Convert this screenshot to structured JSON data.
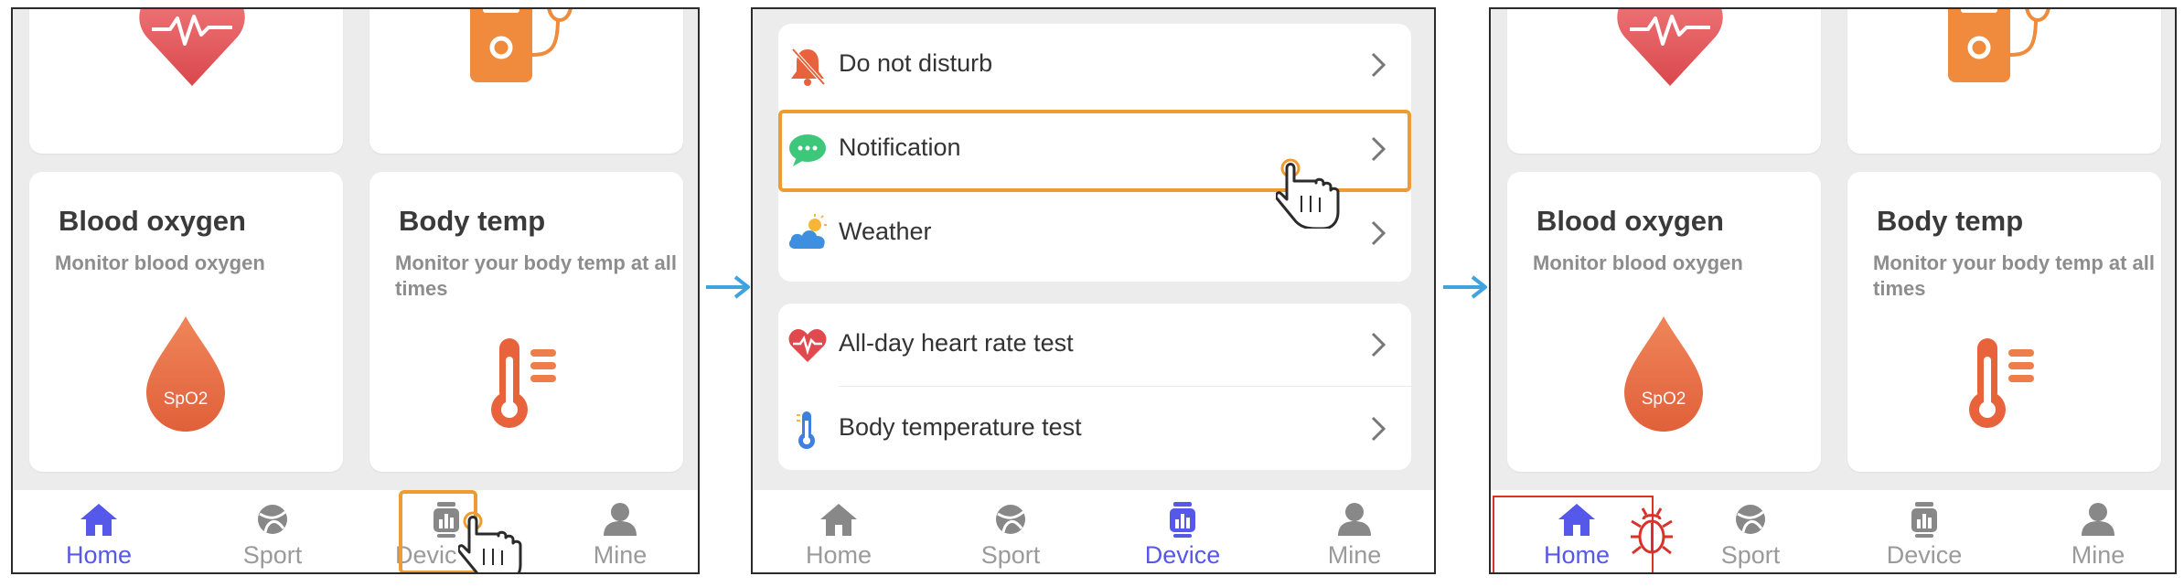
{
  "colors": {
    "accent": "#5558e8",
    "highlight": "#ee9b33",
    "error": "#d9322b",
    "arrow": "#3ea3de",
    "card_bg": "#ffffff",
    "screen_bg": "#ececec"
  },
  "home": {
    "cards": {
      "blood_oxygen": {
        "title": "Blood oxygen",
        "subtitle": "Monitor blood oxygen",
        "icon_label": "SpO2"
      },
      "body_temp": {
        "title": "Body temp",
        "subtitle": "Monitor your body temp at all times"
      }
    }
  },
  "tabs": [
    {
      "label": "Home",
      "icon": "home-icon"
    },
    {
      "label": "Sport",
      "icon": "sport-icon"
    },
    {
      "label": "Device",
      "icon": "device-icon"
    },
    {
      "label": "Mine",
      "icon": "mine-icon"
    }
  ],
  "device": {
    "group1": [
      {
        "label": "Do not disturb",
        "icon": "bell-off-icon"
      },
      {
        "label": "Notification",
        "icon": "chat-bubble-icon"
      },
      {
        "label": "Weather",
        "icon": "weather-icon"
      }
    ],
    "group2": [
      {
        "label": "All-day heart rate test",
        "icon": "heart-rate-icon"
      },
      {
        "label": "Body temperature test",
        "icon": "thermometer-icon"
      }
    ]
  },
  "annotations": {
    "panel1_tab_partial": "Devic"
  }
}
